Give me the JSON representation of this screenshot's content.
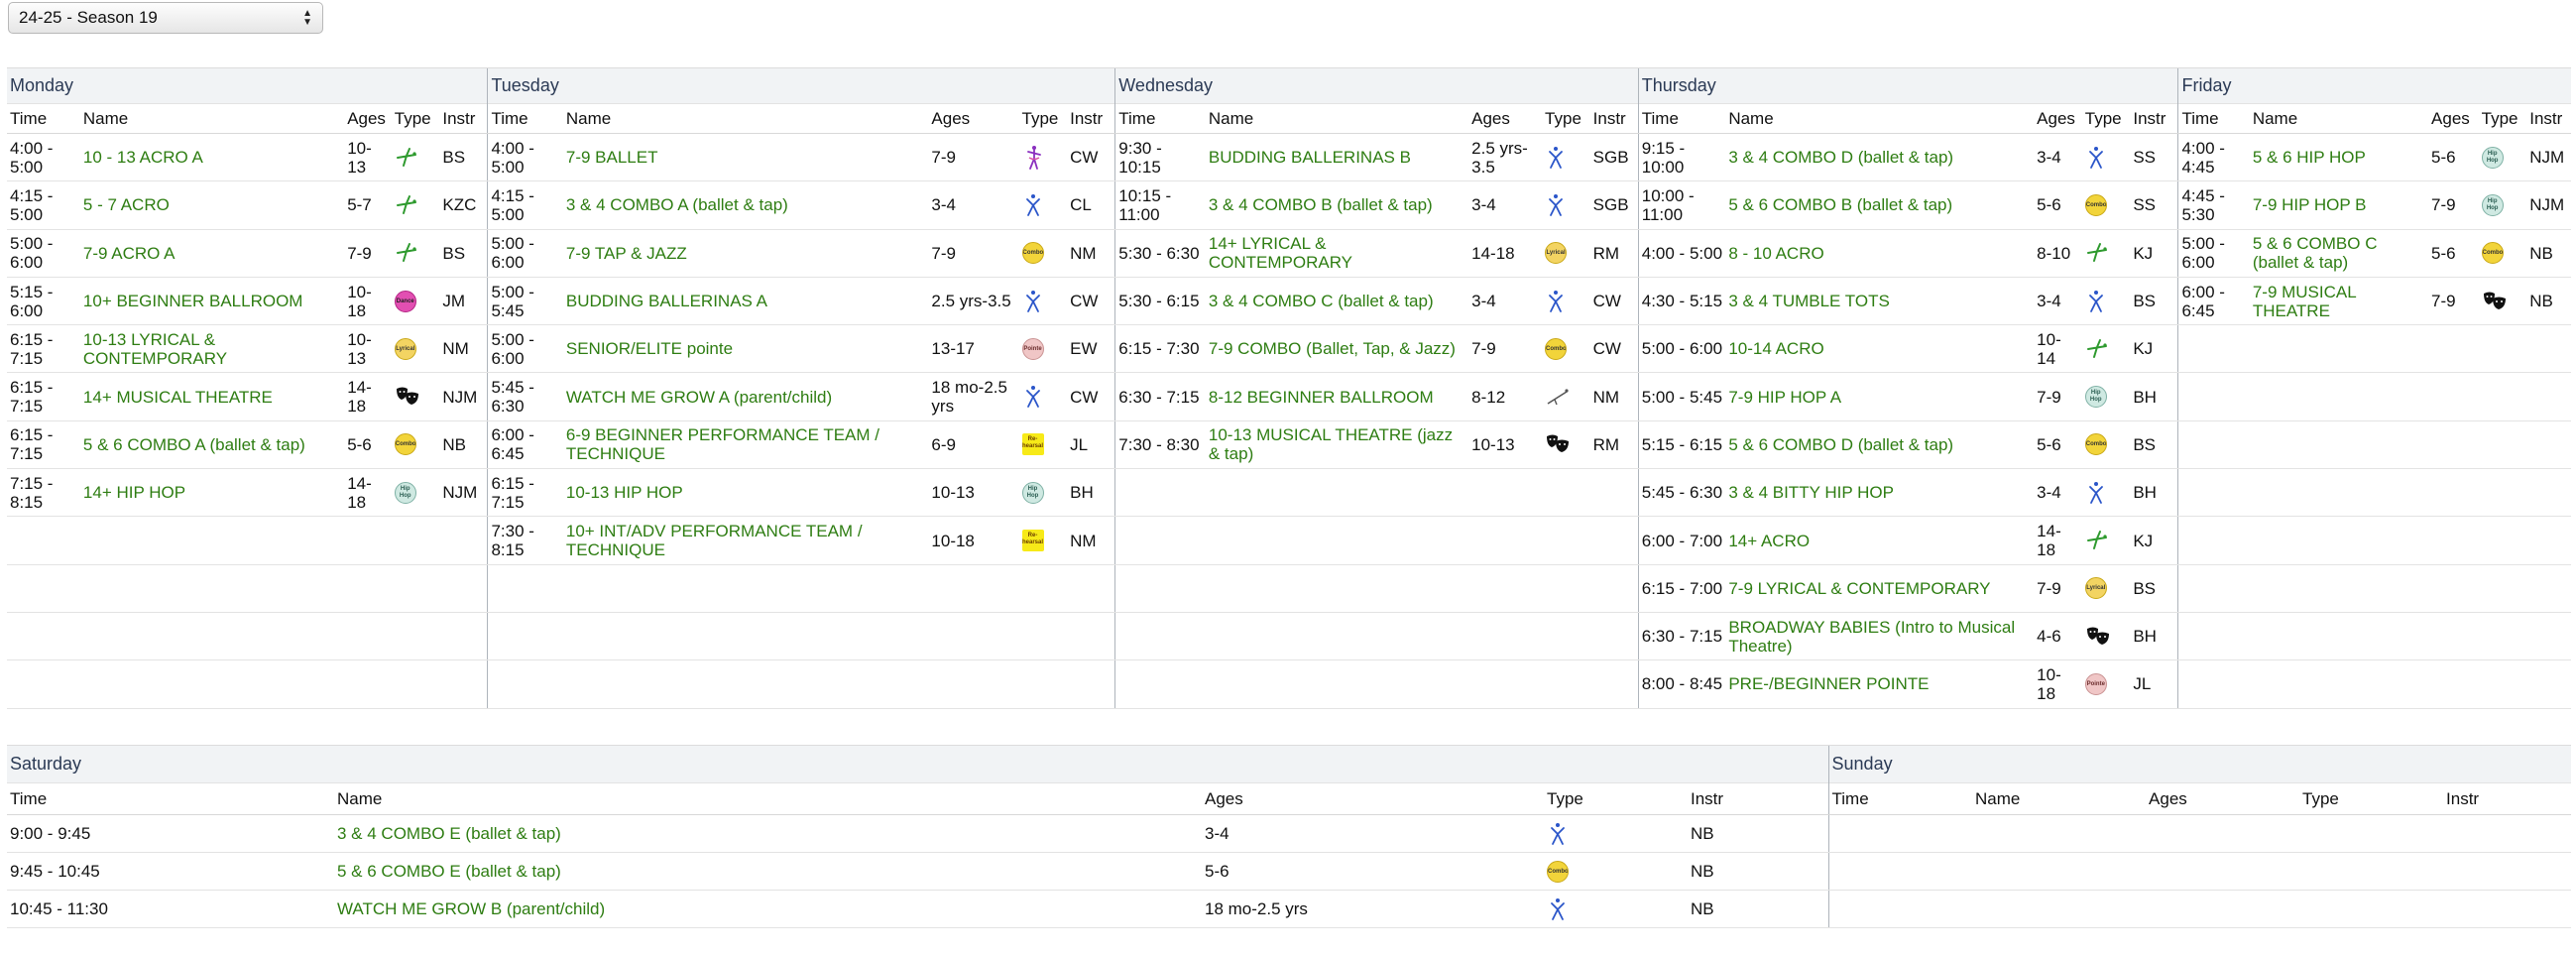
{
  "season_select": {
    "value": "24-25 - Season 19"
  },
  "week1": {
    "days": [
      "Monday",
      "Tuesday",
      "Wednesday",
      "Thursday",
      "Friday"
    ],
    "headers": [
      "Time",
      "Name",
      "Ages",
      "Type",
      "Instr"
    ],
    "rows": [
      [
        {
          "time": "4:00 - 5:00",
          "name": "10 - 13 ACRO A",
          "ages": "10-13",
          "type": "acro",
          "instr": "BS"
        },
        {
          "time": "4:00 - 5:00",
          "name": "7-9 BALLET",
          "ages": "7-9",
          "type": "ballet",
          "instr": "CW"
        },
        {
          "time": "9:30 - 10:15",
          "name": "BUDDING BALLERINAS B",
          "ages": "2.5 yrs-3.5",
          "type": "tap",
          "instr": "SGB"
        },
        {
          "time": "9:15 - 10:00",
          "name": "3 & 4 COMBO D (ballet & tap)",
          "ages": "3-4",
          "type": "tap",
          "instr": "SS"
        },
        {
          "time": "4:00 - 4:45",
          "name": "5 & 6 HIP HOP",
          "ages": "5-6",
          "type": "hiphop",
          "instr": "NJM"
        }
      ],
      [
        {
          "time": "4:15 - 5:00",
          "name": "5 - 7 ACRO",
          "ages": "5-7",
          "type": "acro",
          "instr": "KZC"
        },
        {
          "time": "4:15 - 5:00",
          "name": "3 & 4 COMBO A (ballet & tap)",
          "ages": "3-4",
          "type": "tap",
          "instr": "CL"
        },
        {
          "time": "10:15 - 11:00",
          "name": "3 & 4 COMBO B (ballet & tap)",
          "ages": "3-4",
          "type": "tap",
          "instr": "SGB"
        },
        {
          "time": "10:00 - 11:00",
          "name": "5 & 6 COMBO B (ballet & tap)",
          "ages": "5-6",
          "type": "combo",
          "instr": "SS"
        },
        {
          "time": "4:45 - 5:30",
          "name": "7-9 HIP HOP B",
          "ages": "7-9",
          "type": "hiphop",
          "instr": "NJM"
        }
      ],
      [
        {
          "time": "5:00 - 6:00",
          "name": "7-9 ACRO A",
          "ages": "7-9",
          "type": "acro",
          "instr": "BS"
        },
        {
          "time": "5:00 - 6:00",
          "name": "7-9 TAP & JAZZ",
          "ages": "7-9",
          "type": "combo",
          "instr": "NM"
        },
        {
          "time": "5:30 - 6:30",
          "name": "14+ LYRICAL & CONTEMPORARY",
          "ages": "14-18",
          "type": "lyrical",
          "instr": "RM"
        },
        {
          "time": "4:00 - 5:00",
          "name": "8 - 10 ACRO",
          "ages": "8-10",
          "type": "acro",
          "instr": "KJ"
        },
        {
          "time": "5:00 - 6:00",
          "name": "5 & 6 COMBO C (ballet & tap)",
          "ages": "5-6",
          "type": "combo",
          "instr": "NB"
        }
      ],
      [
        {
          "time": "5:15 - 6:00",
          "name": "10+ BEGINNER BALLROOM",
          "ages": "10-18",
          "type": "dance",
          "instr": "JM"
        },
        {
          "time": "5:00 - 5:45",
          "name": "BUDDING BALLERINAS A",
          "ages": "2.5 yrs-3.5",
          "type": "tap",
          "instr": "CW"
        },
        {
          "time": "5:30 - 6:15",
          "name": "3 & 4 COMBO C (ballet & tap)",
          "ages": "3-4",
          "type": "tap",
          "instr": "CW"
        },
        {
          "time": "4:30 - 5:15",
          "name": "3 & 4 TUMBLE TOTS",
          "ages": "3-4",
          "type": "tap",
          "instr": "BS"
        },
        {
          "time": "6:00 - 6:45",
          "name": "7-9 MUSICAL THEATRE",
          "ages": "7-9",
          "type": "theatre",
          "instr": "NB"
        }
      ],
      [
        {
          "time": "6:15 - 7:15",
          "name": "10-13 LYRICAL & CONTEMPORARY",
          "ages": "10-13",
          "type": "lyrical",
          "instr": "NM"
        },
        {
          "time": "5:00 - 6:00",
          "name": "SENIOR/ELITE pointe",
          "ages": "13-17",
          "type": "pointe",
          "instr": "EW"
        },
        {
          "time": "6:15 - 7:30",
          "name": "7-9 COMBO (Ballet, Tap, & Jazz)",
          "ages": "7-9",
          "type": "combo",
          "instr": "CW"
        },
        {
          "time": "5:00 - 6:00",
          "name": "10-14 ACRO",
          "ages": "10-14",
          "type": "acro",
          "instr": "KJ"
        },
        null
      ],
      [
        {
          "time": "6:15 - 7:15",
          "name": "14+ MUSICAL THEATRE",
          "ages": "14-18",
          "type": "theatre",
          "instr": "NJM"
        },
        {
          "time": "5:45 - 6:30",
          "name": "WATCH ME GROW A (parent/child)",
          "ages": "18 mo-2.5 yrs",
          "type": "tap",
          "instr": "CW"
        },
        {
          "time": "6:30 - 7:15",
          "name": "8-12 BEGINNER BALLROOM",
          "ages": "8-12",
          "type": "ballroom",
          "instr": "NM"
        },
        {
          "time": "5:00 - 5:45",
          "name": "7-9 HIP HOP A",
          "ages": "7-9",
          "type": "hiphop",
          "instr": "BH"
        },
        null
      ],
      [
        {
          "time": "6:15 - 7:15",
          "name": "5 & 6 COMBO A (ballet & tap)",
          "ages": "5-6",
          "type": "combo",
          "instr": "NB"
        },
        {
          "time": "6:00 - 6:45",
          "name": "6-9 BEGINNER PERFORMANCE TEAM / TECHNIQUE",
          "ages": "6-9",
          "type": "rehearsal",
          "instr": "JL"
        },
        {
          "time": "7:30 - 8:30",
          "name": "10-13 MUSICAL THEATRE (jazz & tap)",
          "ages": "10-13",
          "type": "theatre",
          "instr": "RM"
        },
        {
          "time": "5:15 - 6:15",
          "name": "5 & 6 COMBO D (ballet & tap)",
          "ages": "5-6",
          "type": "combo",
          "instr": "BS"
        },
        null
      ],
      [
        {
          "time": "7:15 - 8:15",
          "name": "14+ HIP HOP",
          "ages": "14-18",
          "type": "hiphop",
          "instr": "NJM"
        },
        {
          "time": "6:15 - 7:15",
          "name": "10-13 HIP HOP",
          "ages": "10-13",
          "type": "hiphop",
          "instr": "BH"
        },
        null,
        {
          "time": "5:45 - 6:30",
          "name": "3 & 4 BITTY HIP HOP",
          "ages": "3-4",
          "type": "tap",
          "instr": "BH"
        },
        null
      ],
      [
        null,
        {
          "time": "7:30 - 8:15",
          "name": "10+ INT/ADV PERFORMANCE TEAM / TECHNIQUE",
          "ages": "10-18",
          "type": "rehearsal",
          "instr": "NM"
        },
        null,
        {
          "time": "6:00 - 7:00",
          "name": "14+ ACRO",
          "ages": "14-18",
          "type": "acro",
          "instr": "KJ"
        },
        null
      ],
      [
        null,
        null,
        null,
        {
          "time": "6:15 - 7:00",
          "name": "7-9 LYRICAL & CONTEMPORARY",
          "ages": "7-9",
          "type": "lyrical",
          "instr": "BS"
        },
        null
      ],
      [
        null,
        null,
        null,
        {
          "time": "6:30 - 7:15",
          "name": "BROADWAY BABIES (Intro to Musical Theatre)",
          "ages": "4-6",
          "type": "theatre",
          "instr": "BH"
        },
        null
      ],
      [
        null,
        null,
        null,
        {
          "time": "8:00 - 8:45",
          "name": "PRE-/BEGINNER POINTE",
          "ages": "10-18",
          "type": "pointe",
          "instr": "JL"
        },
        null
      ]
    ]
  },
  "weekend": {
    "days": [
      "Saturday",
      "Sunday"
    ],
    "headers": [
      "Time",
      "Name",
      "Ages",
      "Type",
      "Instr"
    ],
    "saturday_rows": [
      {
        "time": "9:00 - 9:45",
        "name": "3 & 4 COMBO E (ballet & tap)",
        "ages": "3-4",
        "type": "tap",
        "instr": "NB"
      },
      {
        "time": "9:45 - 10:45",
        "name": "5 & 6 COMBO E (ballet & tap)",
        "ages": "5-6",
        "type": "combo",
        "instr": "NB"
      },
      {
        "time": "10:45 - 11:30",
        "name": "WATCH ME GROW B (parent/child)",
        "ages": "18 mo-2.5 yrs",
        "type": "tap",
        "instr": "NB"
      }
    ]
  },
  "type_icons": {
    "combo": {
      "icon": "combo-badge-icon",
      "label": "Combo"
    },
    "lyrical": {
      "icon": "lyrical-badge-icon",
      "label": "Lyrical"
    },
    "hiphop": {
      "icon": "hiphop-badge-icon",
      "label": "Hip Hop"
    },
    "pointe": {
      "icon": "pointe-badge-icon",
      "label": "Pointe"
    },
    "dance": {
      "icon": "dance-badge-icon",
      "label": "Dance"
    },
    "rehearsal": {
      "icon": "rehearsal-badge-icon",
      "label": "Re-hearsal"
    },
    "acro": {
      "icon": "acro-figure-icon",
      "label": ""
    },
    "ballet": {
      "icon": "ballet-figure-icon",
      "label": ""
    },
    "tap": {
      "icon": "tap-figure-icon",
      "label": ""
    },
    "theatre": {
      "icon": "theatre-masks-icon",
      "label": ""
    },
    "ballroom": {
      "icon": "ballroom-figure-icon",
      "label": ""
    }
  },
  "colors": {
    "link_green": "#2e7d12",
    "header_bg": "#f1f3f5",
    "header_text": "#2b3a55"
  }
}
